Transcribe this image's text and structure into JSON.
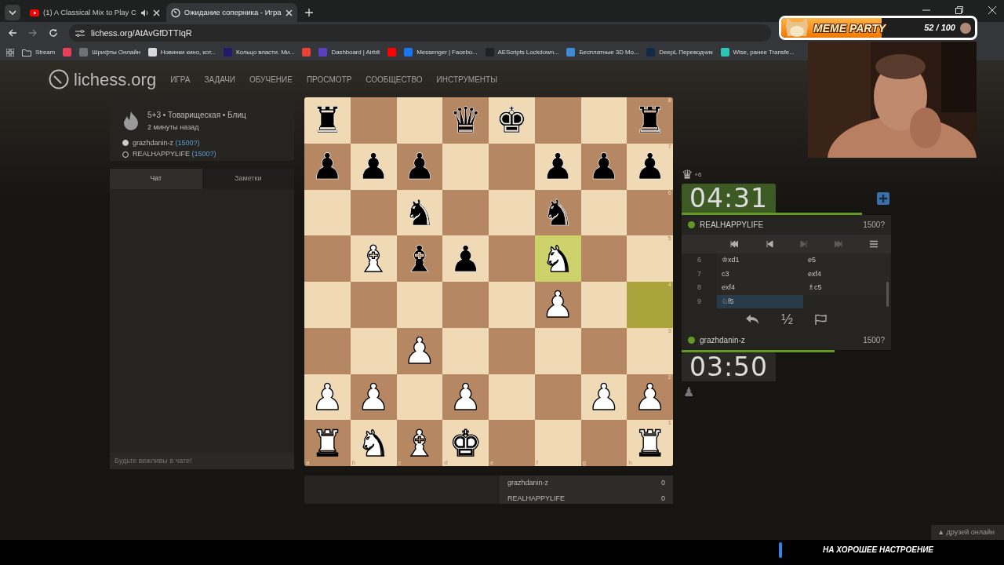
{
  "browser": {
    "tabs": [
      {
        "title": "(1) A Classical Mix to Play C",
        "kind": "youtube",
        "audio": true,
        "selected": false
      },
      {
        "title": "Ожидание соперника - Игра",
        "kind": "lichess",
        "audio": false,
        "selected": true
      }
    ],
    "url": "lichess.org/AtAvGfDTTIqR",
    "bookmarks": [
      {
        "label": "Stream",
        "kind": "folder",
        "color": "#c4c7c5"
      },
      {
        "kind": "site",
        "color": "#e8405a"
      },
      {
        "label": "Шрифты Онлайн",
        "kind": "site",
        "color": "#6e7175"
      },
      {
        "label": "Новинки кино, кот...",
        "kind": "site",
        "color": "#d9d9d9"
      },
      {
        "label": "Кольцо власти. Ми...",
        "kind": "site",
        "color": "#23186b"
      },
      {
        "kind": "site",
        "color": "#ea4335"
      },
      {
        "label": "Dashboard | Airbit",
        "kind": "site",
        "color": "#5b3fc2"
      },
      {
        "kind": "site",
        "color": "#ff0000"
      },
      {
        "label": "Messenger | Facebo...",
        "kind": "site",
        "color": "#1877f2"
      },
      {
        "label": "AEScripts Lockdown...",
        "kind": "site",
        "color": "#202124"
      },
      {
        "label": "Бесплатные 3D Мо...",
        "kind": "site",
        "color": "#3f8ad6"
      },
      {
        "label": "DeepL Переводчик",
        "kind": "site",
        "color": "#0f2b46"
      },
      {
        "label": "Wise, ранее Transfe...",
        "kind": "site",
        "color": "#2ec4b6"
      }
    ]
  },
  "site": {
    "logo": "lichess.org",
    "nav": [
      "ИГРА",
      "ЗАДАЧИ",
      "ОБУЧЕНИЕ",
      "ПРОСМОТР",
      "СООБЩЕСТВО",
      "ИНСТРУМЕНТЫ"
    ]
  },
  "game_info": {
    "title": "5+3 • Товарищеская • Блиц",
    "time": "2 минуты назад",
    "players": [
      {
        "name": "grazhdanin-z",
        "rating": "(1500?)",
        "filled": true
      },
      {
        "name": "REALHAPPYLIFE",
        "rating": "(1500?)",
        "filled": false
      }
    ]
  },
  "chat": {
    "tabs": [
      {
        "label": "Чат",
        "selected": true
      },
      {
        "label": "Заметки",
        "selected": false
      }
    ],
    "placeholder": "Будьте вежливы в чате!"
  },
  "board": {
    "rank_labels": [
      "8",
      "7",
      "6",
      "5",
      "4",
      "3",
      "2",
      "1"
    ],
    "file_labels": [
      "a",
      "b",
      "c",
      "d",
      "e",
      "f",
      "g",
      "h"
    ],
    "ranks": [
      [
        {
          "kind": "rook",
          "color": "#000000",
          "glyph": "♜",
          "last_move": false
        },
        {
          "kind": "empty",
          "last_move": false
        },
        {
          "kind": "empty",
          "last_move": false
        },
        {
          "kind": "queen",
          "color": "#000000",
          "glyph": "♛",
          "last_move": false
        },
        {
          "kind": "king",
          "color": "#000000",
          "glyph": "♚",
          "last_move": false
        },
        {
          "kind": "empty",
          "last_move": false
        },
        {
          "kind": "empty",
          "last_move": false
        },
        {
          "kind": "rook",
          "color": "#000000",
          "glyph": "♜",
          "last_move": false
        }
      ],
      [
        {
          "kind": "pawn",
          "color": "#000000",
          "glyph": "♟",
          "last_move": false
        },
        {
          "kind": "pawn",
          "color": "#000000",
          "glyph": "♟",
          "last_move": false
        },
        {
          "kind": "pawn",
          "color": "#000000",
          "glyph": "♟",
          "last_move": false
        },
        {
          "kind": "empty",
          "last_move": false
        },
        {
          "kind": "empty",
          "last_move": false
        },
        {
          "kind": "pawn",
          "color": "#000000",
          "glyph": "♟",
          "last_move": false
        },
        {
          "kind": "pawn",
          "color": "#000000",
          "glyph": "♟",
          "last_move": false
        },
        {
          "kind": "pawn",
          "color": "#000000",
          "glyph": "♟",
          "last_move": false
        }
      ],
      [
        {
          "kind": "empty",
          "last_move": false
        },
        {
          "kind": "empty",
          "last_move": false
        },
        {
          "kind": "knight",
          "color": "#000000",
          "glyph": "♞",
          "last_move": false
        },
        {
          "kind": "empty",
          "last_move": false
        },
        {
          "kind": "empty",
          "last_move": false
        },
        {
          "kind": "knight",
          "color": "#000000",
          "glyph": "♞",
          "last_move": false
        },
        {
          "kind": "empty",
          "last_move": false
        },
        {
          "kind": "empty",
          "last_move": false
        }
      ],
      [
        {
          "kind": "empty",
          "last_move": false
        },
        {
          "kind": "bishop",
          "color": "#ffffff",
          "glyph": "♝",
          "last_move": false
        },
        {
          "kind": "bishop",
          "color": "#000000",
          "glyph": "♝",
          "last_move": false
        },
        {
          "kind": "pawn",
          "color": "#000000",
          "glyph": "♟",
          "last_move": false
        },
        {
          "kind": "empty",
          "last_move": false
        },
        {
          "kind": "knight",
          "color": "#ffffff",
          "glyph": "♞",
          "last_move": true
        },
        {
          "kind": "empty",
          "last_move": false
        },
        {
          "kind": "empty",
          "last_move": false
        }
      ],
      [
        {
          "kind": "empty",
          "last_move": false
        },
        {
          "kind": "empty",
          "last_move": false
        },
        {
          "kind": "empty",
          "last_move": false
        },
        {
          "kind": "empty",
          "last_move": false
        },
        {
          "kind": "empty",
          "last_move": false
        },
        {
          "kind": "pawn",
          "color": "#ffffff",
          "glyph": "♟",
          "last_move": false
        },
        {
          "kind": "empty",
          "last_move": false
        },
        {
          "kind": "empty",
          "last_move": true
        }
      ],
      [
        {
          "kind": "empty",
          "last_move": false
        },
        {
          "kind": "empty",
          "last_move": false
        },
        {
          "kind": "pawn",
          "color": "#ffffff",
          "glyph": "♟",
          "last_move": false
        },
        {
          "kind": "empty",
          "last_move": false
        },
        {
          "kind": "empty",
          "last_move": false
        },
        {
          "kind": "empty",
          "last_move": false
        },
        {
          "kind": "empty",
          "last_move": false
        },
        {
          "kind": "empty",
          "last_move": false
        }
      ],
      [
        {
          "kind": "pawn",
          "color": "#ffffff",
          "glyph": "♟",
          "last_move": false
        },
        {
          "kind": "pawn",
          "color": "#ffffff",
          "glyph": "♟",
          "last_move": false
        },
        {
          "kind": "empty",
          "last_move": false
        },
        {
          "kind": "pawn",
          "color": "#ffffff",
          "glyph": "♟",
          "last_move": false
        },
        {
          "kind": "empty",
          "last_move": false
        },
        {
          "kind": "empty",
          "last_move": false
        },
        {
          "kind": "pawn",
          "color": "#ffffff",
          "glyph": "♟",
          "last_move": false
        },
        {
          "kind": "pawn",
          "color": "#ffffff",
          "glyph": "♟",
          "last_move": false
        }
      ],
      [
        {
          "kind": "rook",
          "color": "#ffffff",
          "glyph": "♜",
          "last_move": false
        },
        {
          "kind": "knight",
          "color": "#ffffff",
          "glyph": "♞",
          "last_move": false
        },
        {
          "kind": "bishop",
          "color": "#ffffff",
          "glyph": "♝",
          "last_move": false
        },
        {
          "kind": "king",
          "color": "#ffffff",
          "glyph": "♚",
          "last_move": false
        },
        {
          "kind": "empty",
          "last_move": false
        },
        {
          "kind": "empty",
          "last_move": false
        },
        {
          "kind": "empty",
          "last_move": false
        },
        {
          "kind": "rook",
          "color": "#ffffff",
          "glyph": "♜",
          "last_move": false
        }
      ]
    ]
  },
  "score_table": [
    {
      "name": "grazhdanin-z",
      "score": "0"
    },
    {
      "name": "REALHAPPYLIFE",
      "score": "0"
    }
  ],
  "clock_panel": {
    "material_top": {
      "glyph": "♛",
      "text": "+6"
    },
    "top": {
      "time": "04:31",
      "running": true,
      "level": 0.86,
      "name": "REALHAPPYLIFE",
      "rating": "1500?",
      "online": true
    },
    "controls": [
      {
        "kind": "first",
        "disabled": false
      },
      {
        "kind": "prev",
        "disabled": false
      },
      {
        "kind": "next",
        "disabled": true
      },
      {
        "kind": "last",
        "disabled": true
      },
      {
        "kind": "menu",
        "disabled": false
      }
    ],
    "moves": [
      {
        "number": "6",
        "white": {
          "text": "♔xd1",
          "selected": false
        },
        "black": {
          "text": "e5",
          "selected": false
        }
      },
      {
        "number": "7",
        "white": {
          "text": "c3",
          "selected": false
        },
        "black": {
          "text": "exf4",
          "selected": false
        }
      },
      {
        "number": "8",
        "white": {
          "text": "exf4",
          "selected": false
        },
        "black": {
          "text": "♗c5",
          "selected": false
        }
      },
      {
        "number": "9",
        "white": {
          "text": "♘f5",
          "selected": true
        }
      }
    ],
    "draw_label": "½",
    "bottom": {
      "time": "03:50",
      "running": false,
      "level": 0.73,
      "name": "grazhdanin-z",
      "rating": "1500?",
      "online": true
    },
    "material_bottom": {
      "glyph": "♟"
    }
  },
  "friends": {
    "label": "друзей онлайн",
    "caret": "▲"
  },
  "overlay": {
    "title": "MEME PARTY",
    "level": 0.52,
    "count": "52 / 100",
    "caption": "НА ХОРОШЕЕ НАСТРОЕНИЕ"
  }
}
